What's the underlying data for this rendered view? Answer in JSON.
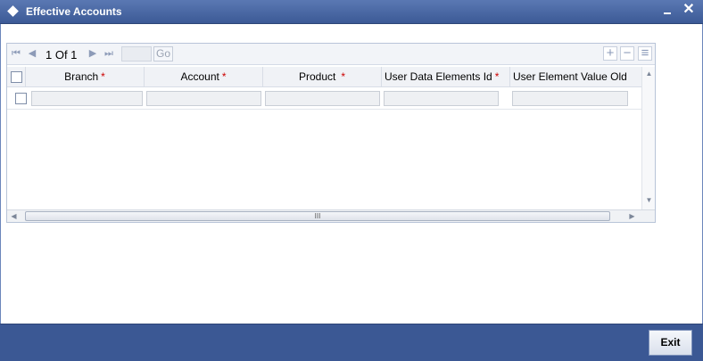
{
  "window": {
    "title": "Effective Accounts",
    "minimize_glyph": "",
    "close_glyph": "✕"
  },
  "pager": {
    "page_text": "1 Of 1",
    "go_label": "Go",
    "first_glyph": "⏮",
    "prev_glyph": "◀",
    "next_glyph": "▶",
    "last_glyph": "⏭"
  },
  "toolbar": {
    "add_glyph": "+",
    "delete_glyph": "−",
    "view_glyph": "≡"
  },
  "table": {
    "required_mark": "*",
    "columns": [
      {
        "label": "Branch",
        "required": true
      },
      {
        "label": "Account",
        "required": true
      },
      {
        "label": "Product",
        "required": true
      },
      {
        "label": "User Data Elements Id",
        "required": true
      },
      {
        "label": "User Element Value Old",
        "required": false
      }
    ],
    "rows": [
      {
        "branch": "",
        "account": "",
        "product": "",
        "user_data_elements_id": "",
        "user_element_value_old": ""
      }
    ]
  },
  "scroll": {
    "up_glyph": "▲",
    "down_glyph": "▼",
    "left_glyph": "◀",
    "right_glyph": "▶",
    "thumb_grip": "III"
  },
  "footer": {
    "exit_label": "Exit"
  }
}
